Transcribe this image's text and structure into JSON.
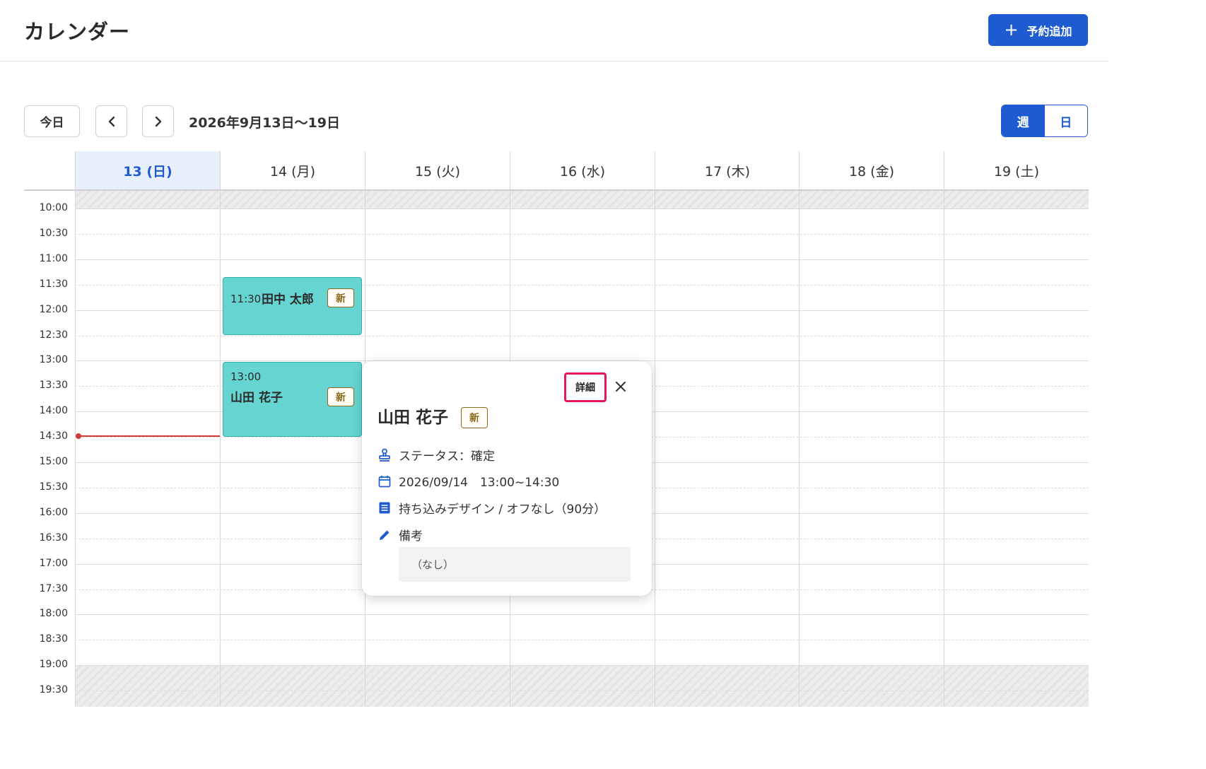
{
  "header": {
    "title": "カレンダー",
    "add_button_label": "予約追加"
  },
  "toolbar": {
    "today_label": "今日",
    "date_range": "2026年9月13日〜19日",
    "view_week_label": "週",
    "view_day_label": "日",
    "active_view": "週"
  },
  "calendar": {
    "days": [
      "13 (日)",
      "14 (月)",
      "15 (火)",
      "16 (水)",
      "17 (木)",
      "18 (金)",
      "19 (土)"
    ],
    "today_index": 0,
    "times": [
      "10:00",
      "10:30",
      "11:00",
      "11:30",
      "12:00",
      "12:30",
      "13:00",
      "13:30",
      "14:00",
      "14:30",
      "15:00",
      "15:30",
      "16:00",
      "16:30",
      "17:00",
      "17:30",
      "18:00",
      "18:30",
      "19:00",
      "19:30"
    ],
    "events": [
      {
        "time": "11:30",
        "name": "田中 太郎",
        "badge": "新"
      },
      {
        "time": "13:00",
        "name": "山田 花子",
        "badge": "新"
      }
    ]
  },
  "popup": {
    "detail_label": "詳細",
    "name": "山田 花子",
    "badge": "新",
    "status": "ステータス：確定",
    "datetime": "2026/09/14　13:00~14:30",
    "menu": "持ち込みデザイン / オフなし（90分）",
    "note_label": "備考",
    "note_value": "（なし）"
  },
  "colors": {
    "accent": "#1f5bd0",
    "event_fill": "#66d4d0",
    "event_border": "#2fb0aa",
    "now_line": "#d23a3a",
    "highlight_box": "#e8155f",
    "badge": "#8a6a1c"
  }
}
